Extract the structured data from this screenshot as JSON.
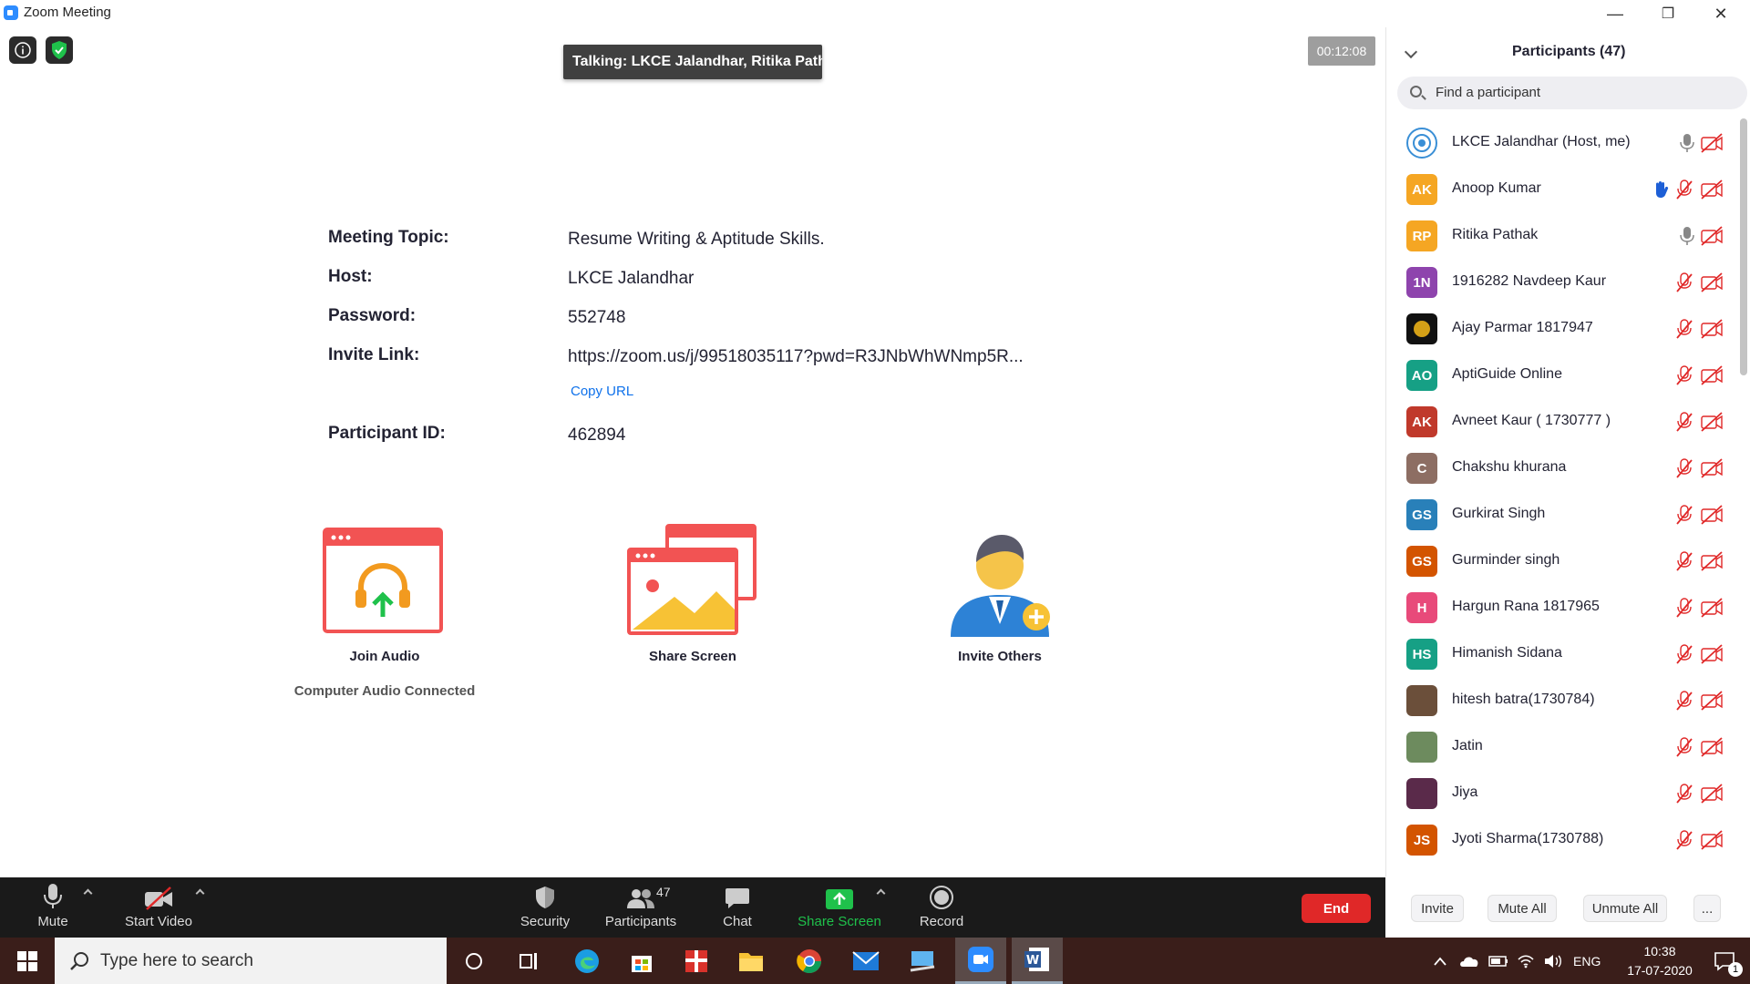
{
  "window": {
    "title": "Zoom Meeting",
    "minimize": "—",
    "restore": "❐",
    "close": "✕"
  },
  "status": {
    "talking": "Talking: LKCE Jalandhar, Ritika Pathak",
    "timer": "00:12:08"
  },
  "meeting_info": {
    "topic_label": "Meeting Topic:",
    "topic": "Resume Writing & Aptitude Skills.",
    "host_label": "Host:",
    "host": "LKCE Jalandhar",
    "password_label": "Password:",
    "password": "552748",
    "invite_label": "Invite Link:",
    "invite_link": "https://zoom.us/j/99518035117?pwd=R3JNbWhWNmp5R...",
    "copy_url": "Copy URL",
    "participant_id_label": "Participant ID:",
    "participant_id": "462894"
  },
  "actions": {
    "join_audio": "Join Audio",
    "audio_status": "Computer Audio Connected",
    "share_screen": "Share Screen",
    "invite_others": "Invite Others"
  },
  "participants_panel": {
    "title": "Participants (47)",
    "search_placeholder": "Find a participant",
    "participants": [
      {
        "name": "LKCE Jalandhar (Host, me)",
        "initials": "",
        "color": "#ffffff",
        "audio": "on",
        "hand": false
      },
      {
        "name": "Anoop Kumar",
        "initials": "AK",
        "color": "#f5a623",
        "audio": "muted",
        "hand": true
      },
      {
        "name": "Ritika Pathak",
        "initials": "RP",
        "color": "#f5a623",
        "audio": "on",
        "hand": false
      },
      {
        "name": "1916282 Navdeep Kaur",
        "initials": "1N",
        "color": "#8e44ad",
        "audio": "muted",
        "hand": false
      },
      {
        "name": "Ajay Parmar 1817947",
        "initials": "",
        "color": "#111111",
        "audio": "muted",
        "hand": false
      },
      {
        "name": "AptiGuide Online",
        "initials": "AO",
        "color": "#16a085",
        "audio": "muted",
        "hand": false
      },
      {
        "name": "Avneet Kaur ( 1730777 )",
        "initials": "AK",
        "color": "#c0392b",
        "audio": "muted",
        "hand": false
      },
      {
        "name": "Chakshu khurana",
        "initials": "C",
        "color": "#8d6e63",
        "audio": "muted",
        "hand": false
      },
      {
        "name": "Gurkirat Singh",
        "initials": "GS",
        "color": "#2980b9",
        "audio": "muted",
        "hand": false
      },
      {
        "name": "Gurminder singh",
        "initials": "GS",
        "color": "#d35400",
        "audio": "muted",
        "hand": false
      },
      {
        "name": "Hargun Rana 1817965",
        "initials": "H",
        "color": "#e84a7a",
        "audio": "muted",
        "hand": false
      },
      {
        "name": "Himanish Sidana",
        "initials": "HS",
        "color": "#16a085",
        "audio": "muted",
        "hand": false
      },
      {
        "name": "hitesh batra(1730784)",
        "initials": "",
        "color": "#6b4f3a",
        "audio": "muted",
        "hand": false
      },
      {
        "name": "Jatin",
        "initials": "",
        "color": "#6d8b5e",
        "audio": "muted",
        "hand": false
      },
      {
        "name": "Jiya",
        "initials": "",
        "color": "#5a2a4a",
        "audio": "muted",
        "hand": false
      },
      {
        "name": "Jyoti Sharma(1730788)",
        "initials": "JS",
        "color": "#d35400",
        "audio": "muted",
        "hand": false
      }
    ],
    "buttons": {
      "invite": "Invite",
      "mute_all": "Mute All",
      "unmute_all": "Unmute All",
      "more": "..."
    }
  },
  "controls": {
    "mute": "Mute",
    "start_video": "Start Video",
    "security": "Security",
    "participants": "Participants",
    "participants_count": "47",
    "chat": "Chat",
    "share_screen": "Share Screen",
    "record": "Record",
    "end": "End"
  },
  "taskbar": {
    "search_placeholder": "Type here to search",
    "language": "ENG",
    "time": "10:38",
    "date": "17-07-2020",
    "notification_count": "1"
  },
  "colors": {
    "accent": "#0e71eb",
    "share_green": "#1fc14b",
    "end_red": "#e02828",
    "taskbar": "#3a1e1a"
  }
}
